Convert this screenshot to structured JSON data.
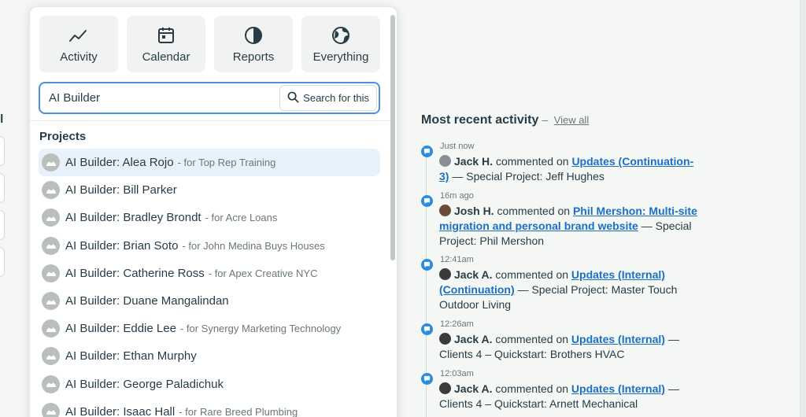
{
  "background_form": {
    "label": "il"
  },
  "filters": [
    {
      "label": "Activity",
      "icon": "activity-icon"
    },
    {
      "label": "Calendar",
      "icon": "calendar-icon"
    },
    {
      "label": "Reports",
      "icon": "reports-icon"
    },
    {
      "label": "Everything",
      "icon": "globe-icon"
    }
  ],
  "search": {
    "value": "AI Builder",
    "button_label": "Search for this"
  },
  "projects": {
    "title": "Projects",
    "items": [
      {
        "name": "AI Builder: Alea Rojo",
        "for": "- for Top Rep Training",
        "active": true
      },
      {
        "name": "AI Builder: Bill Parker",
        "for": ""
      },
      {
        "name": "AI Builder: Bradley Brondt",
        "for": "- for Acre Loans"
      },
      {
        "name": "AI Builder: Brian Soto",
        "for": "- for John Medina Buys Houses"
      },
      {
        "name": "AI Builder: Catherine Ross",
        "for": "- for Apex Creative NYC"
      },
      {
        "name": "AI Builder: Duane Mangalindan",
        "for": ""
      },
      {
        "name": "AI Builder: Eddie Lee",
        "for": "- for Synergy Marketing Technology"
      },
      {
        "name": "AI Builder: Ethan Murphy",
        "for": ""
      },
      {
        "name": "AI Builder: George Paladichuk",
        "for": ""
      },
      {
        "name": "AI Builder: Isaac Hall",
        "for": "- for Rare Breed Plumbing"
      }
    ]
  },
  "activity": {
    "title": "Most recent activity",
    "separator": "–",
    "view_all": "View all",
    "items": [
      {
        "time": "Just now",
        "user": "Jack H.",
        "verb": "commented on",
        "link": "Updates (Continuation-3)",
        "rest": "— Special Project: Jeff Hughes"
      },
      {
        "time": "16m ago",
        "user": "Josh H.",
        "verb": "commented on",
        "link": "Phil Mershon: Multi-site migration and personal brand website",
        "rest": "— Special Project: Phil Mershon"
      },
      {
        "time": "12:41am",
        "user": "Jack A.",
        "verb": "commented on",
        "link": "Updates (Internal) (Continuation)",
        "rest": "— Special Project: Master Touch Outdoor Living"
      },
      {
        "time": "12:26am",
        "user": "Jack A.",
        "verb": "commented on",
        "link": "Updates (Internal)",
        "rest": "— Clients 4 – Quickstart: Brothers HVAC"
      },
      {
        "time": "12:03am",
        "user": "Jack A.",
        "verb": "commented on",
        "link": "Updates (Internal)",
        "rest": "— Clients 4 – Quickstart: Arnett Mechanical"
      }
    ]
  },
  "colors": {
    "accent": "#2a8ce0",
    "link": "#1b6fc4",
    "active_row": "#e7f1fa",
    "text": "#283c46"
  }
}
